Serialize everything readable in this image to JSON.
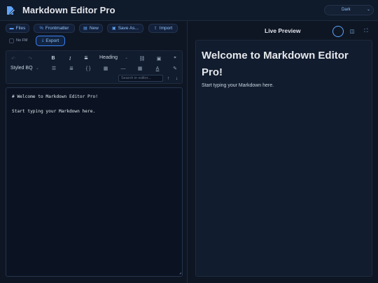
{
  "app": {
    "title": "Markdown Editor Pro",
    "theme": "Dark"
  },
  "toolbar": {
    "files": "Files",
    "frontmatter": "Frontmatter",
    "new": "New",
    "save_as": "Save As...",
    "import": "Import",
    "no_fm_label": "No FM",
    "export": "Export"
  },
  "format": {
    "undo_glyph": "↶",
    "redo_glyph": "↷",
    "bold_glyph": "B",
    "italic_glyph": "I",
    "strike_glyph": "S",
    "heading_select": "Heading",
    "link_glyph": "⛓",
    "image_glyph": "▣",
    "quote_glyph": "❞",
    "blockquote_select": "Styled BQ",
    "bullet_glyph": "☰",
    "numbered_glyph": "≣",
    "code_glyph": "{ }",
    "codeblock_glyph": "▦",
    "hr_glyph": "—",
    "table_glyph": "▦",
    "textcolor_glyph": "A",
    "highlight_glyph": "✎",
    "search_placeholder": "Search in editor...",
    "prev_glyph": "↑",
    "next_glyph": "↓"
  },
  "editor": {
    "line1": "# Welcome to Markdown Editor Pro!",
    "line2": "Start typing your Markdown here."
  },
  "preview": {
    "title": "Live Preview",
    "heading": "Welcome to Markdown Editor Pro!",
    "paragraph": "Start typing your Markdown here."
  },
  "colors": {
    "background": "#0e1624",
    "accent": "#60a5fa",
    "panel": "#111c2e"
  }
}
